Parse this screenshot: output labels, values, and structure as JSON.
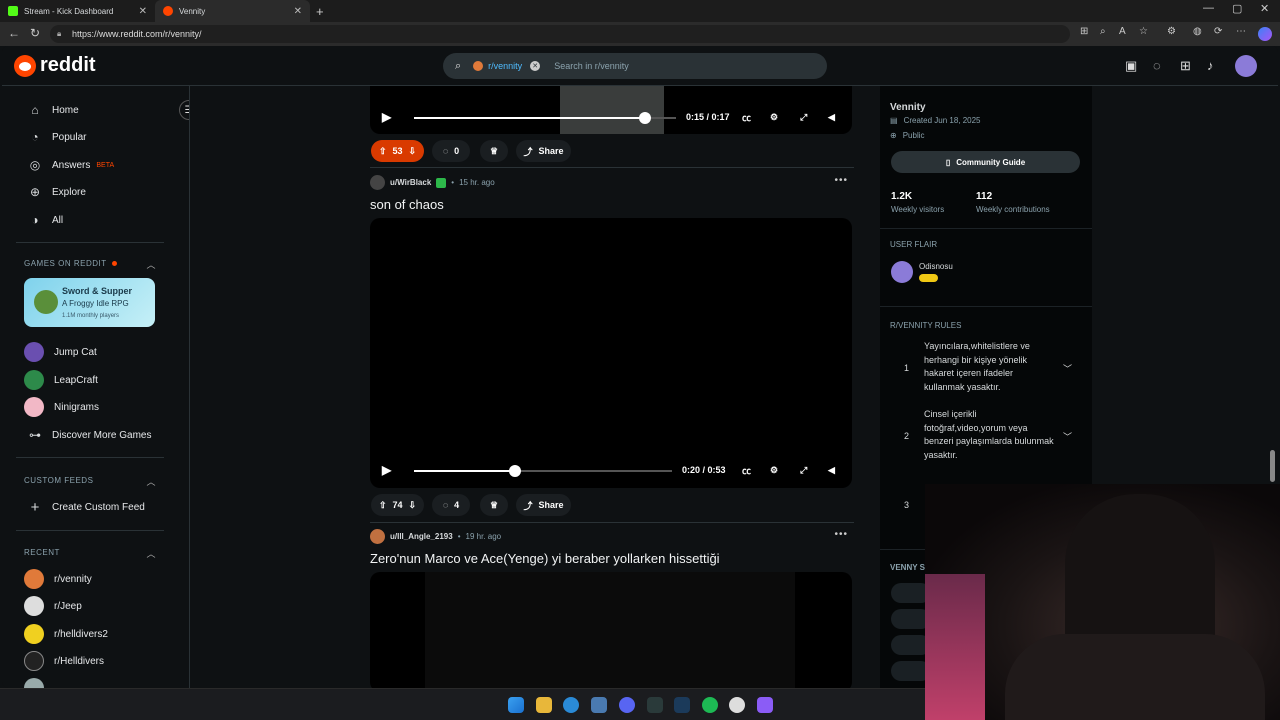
{
  "browser": {
    "tabs": [
      {
        "label": "Stream - Kick Dashboard",
        "icon": "kick-icon"
      },
      {
        "label": "Vennity",
        "icon": "reddit-icon"
      }
    ],
    "url": "https://www.reddit.com/r/vennity/"
  },
  "header": {
    "logo_text": "reddit",
    "search_chip": "r/vennity",
    "search_placeholder": "Search in r/vennity"
  },
  "sidebar": {
    "main_nav": [
      {
        "label": "Home",
        "icon": "home-icon"
      },
      {
        "label": "Popular",
        "icon": "popular-icon"
      },
      {
        "label": "Answers",
        "badge": "BETA",
        "icon": "answers-icon"
      },
      {
        "label": "Explore",
        "icon": "explore-icon"
      },
      {
        "label": "All",
        "icon": "all-icon"
      }
    ],
    "games_header": "GAMES ON REDDIT",
    "game_card": {
      "title": "Sword & Supper",
      "subtitle": "A Froggy Idle RPG",
      "players": "1.1M monthly players"
    },
    "games": [
      "Jump Cat",
      "LeapCraft",
      "Ninigrams",
      "Discover More Games"
    ],
    "custom_feeds_header": "CUSTOM FEEDS",
    "create_feed": "Create Custom Feed",
    "recent_header": "RECENT",
    "recent": [
      "r/vennity",
      "r/Jeep",
      "r/helldivers2",
      "r/Helldivers"
    ]
  },
  "posts": [
    {
      "time": "0:15 / 0:17",
      "progress": 0.88,
      "votes": "53",
      "comments": "0",
      "share": "Share"
    },
    {
      "author": "u/WirBlack",
      "age": "15 hr. ago",
      "title": "son of chaos",
      "time": "0:20 / 0:53",
      "progress": 0.39,
      "votes": "74",
      "comments": "4",
      "share": "Share"
    },
    {
      "author": "u/Ill_Angle_2193",
      "age": "19 hr. ago",
      "title": "Zero'nun Marco ve Ace(Yenge) yi beraber yollarken hissettiği"
    }
  ],
  "community": {
    "name": "Vennity",
    "created": "Created Jun 18, 2025",
    "visibility": "Public",
    "guide_button": "Community Guide",
    "stats": [
      {
        "value": "1.2K",
        "label": "Weekly visitors"
      },
      {
        "value": "112",
        "label": "Weekly contributions"
      }
    ],
    "user_flair_header": "USER FLAIR",
    "flair_user": "Odisnosu",
    "rules_header": "R/VENNITY RULES",
    "rules": [
      {
        "num": "1",
        "text": "Yayıncılara,whitelistlere ve herhangi bir kişiye yönelik hakaret içeren ifadeler kullanmak yasaktır."
      },
      {
        "num": "2",
        "text": "Cinsel içerikli fotoğraf,video,yorum veya benzeri paylaşımlarda bulunmak yasaktır."
      },
      {
        "num": "3",
        "text": ""
      }
    ],
    "lower_section": "VENNY S"
  },
  "colors": {
    "accent": "#ff4500",
    "link": "#4fbcff",
    "background": "#0e1113"
  }
}
